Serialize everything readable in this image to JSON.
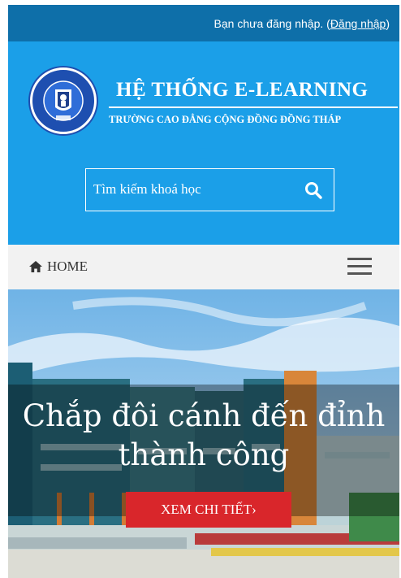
{
  "login_bar": {
    "status_text": "Bạn chưa đăng nhập. (",
    "login_link": "Đăng nhập",
    "close_paren": ")"
  },
  "header": {
    "title": "HỆ THỐNG E-LEARNING",
    "subtitle": "TRƯỜNG CAO ĐẲNG CỘNG ĐỒNG ĐỒNG THÁP",
    "logo_icon": "school-logo-icon",
    "search": {
      "placeholder": "Tìm kiếm khoá học",
      "icon": "search-icon"
    }
  },
  "nav": {
    "home_label": "HOME",
    "home_icon": "home-icon",
    "menu_icon": "hamburger-menu-icon"
  },
  "hero": {
    "heading": "Chắp đôi cánh đến đỉnh thành công",
    "button_label": "XEM CHI TIẾT›"
  },
  "colors": {
    "login_bar": "#0e6fa9",
    "header": "#1b9fe8",
    "nav": "#f2f2f2",
    "cta": "#d9262b"
  }
}
